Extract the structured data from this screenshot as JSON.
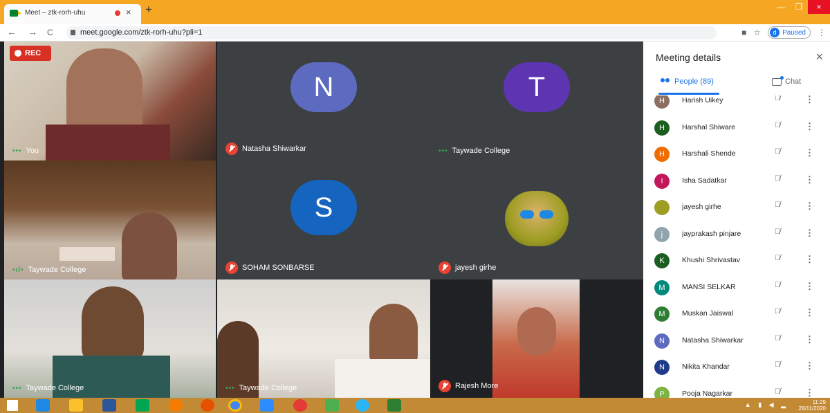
{
  "browser": {
    "tab_title": "Meet – ztk-rorh-uhu",
    "tab_close": "×",
    "new_tab": "+",
    "url": "meet.google.com/ztk-rorh-uhu?pli=1",
    "back": "←",
    "forward": "→",
    "reload": "C",
    "profile_initial": "d",
    "profile_status": "Paused",
    "menu": "⋮",
    "star": "☆",
    "cam": "■",
    "win_min": "—",
    "win_max": "❐",
    "win_close": "×"
  },
  "meet": {
    "rec_label": "REC",
    "tiles": [
      {
        "name": "You",
        "status": "dots"
      },
      {
        "name": "Natasha Shiwarkar",
        "status": "muted",
        "initial": "N",
        "color": "#5c6bc0"
      },
      {
        "name": "Taywade College",
        "status": "dots",
        "initial": "T",
        "color": "#5e35b1"
      },
      {
        "name": "Taywade College",
        "status": "speaking"
      },
      {
        "name": "SOHAM SONBARSE",
        "status": "muted",
        "initial": "S",
        "color": "#1565c0"
      },
      {
        "name": "jayesh girhe",
        "status": "muted"
      },
      {
        "name": "Taywade College",
        "status": "dots"
      },
      {
        "name": "Taywade College",
        "status": "dots"
      },
      {
        "name": "Rajesh More",
        "status": "muted"
      }
    ]
  },
  "panel": {
    "title": "Meeting details",
    "close": "×",
    "people_tab": "People (89)",
    "chat_tab": "Chat",
    "mic_icon": "🎙",
    "more_icon": "⋮",
    "people": [
      {
        "initial": "H",
        "name": "Harish Uikey",
        "color": "#8d6e63"
      },
      {
        "initial": "H",
        "name": "Harshal Shiware",
        "color": "#1b5e20"
      },
      {
        "initial": "H",
        "name": "Harshali Shende",
        "color": "#ef6c00"
      },
      {
        "initial": "I",
        "name": "Isha Sadatkar",
        "color": "#c2185b"
      },
      {
        "initial": "",
        "name": "jayesh girhe",
        "color": "#9e9d24"
      },
      {
        "initial": "j",
        "name": "jayprakash pinjare",
        "color": "#90a4ae"
      },
      {
        "initial": "K",
        "name": "Khushi Shrivastav",
        "color": "#1b5e20"
      },
      {
        "initial": "M",
        "name": "MANSI SELKAR",
        "color": "#00897b"
      },
      {
        "initial": "M",
        "name": "Muskan Jaiswal",
        "color": "#2e7d32"
      },
      {
        "initial": "N",
        "name": "Natasha Shiwarkar",
        "color": "#5c6bc0"
      },
      {
        "initial": "N",
        "name": "Nikita Khandar",
        "color": "#1e3a8a"
      },
      {
        "initial": "P",
        "name": "Pooja Nagarkar",
        "color": "#7cb342"
      }
    ]
  },
  "taskbar": {
    "time": "11:29",
    "date": "28/11/2020"
  }
}
